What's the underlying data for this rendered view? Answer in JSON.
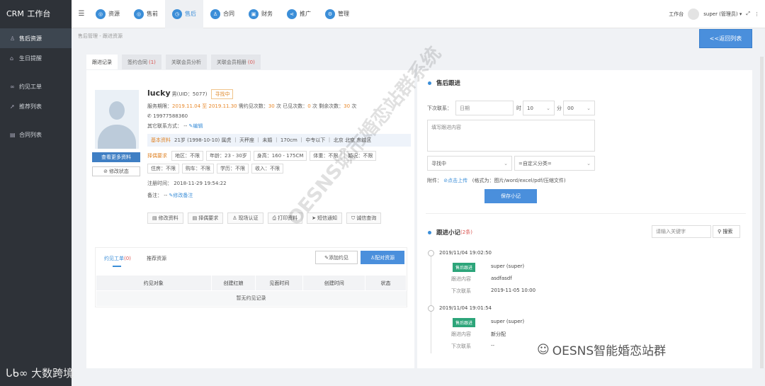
{
  "app": {
    "title": "CRM",
    "subtitle": "工作台"
  },
  "sidebar": {
    "items": [
      {
        "label": "售后资源",
        "icon": "user-icon",
        "active": true
      },
      {
        "label": "生日提醒",
        "icon": "gift-icon"
      },
      {
        "label": "约见工单",
        "icon": "link-icon"
      },
      {
        "label": "推荐列表",
        "icon": "share-icon"
      },
      {
        "label": "合同列表",
        "icon": "document-icon"
      }
    ],
    "brand": "大数跨境"
  },
  "topnav": {
    "items": [
      {
        "label": "资源",
        "icon": "globe-icon"
      },
      {
        "label": "售前",
        "icon": "globe-icon"
      },
      {
        "label": "售后",
        "icon": "clock-icon",
        "active": true
      },
      {
        "label": "合同",
        "icon": "user-icon"
      },
      {
        "label": "财务",
        "icon": "finance-icon"
      },
      {
        "label": "推广",
        "icon": "share-icon"
      },
      {
        "label": "管理",
        "icon": "settings-icon"
      }
    ],
    "workbench": "工作台",
    "user": "super (管理员)"
  },
  "breadcrumb": "售后管理 - 跟进资源",
  "back_button": "<<返回列表",
  "tabs": [
    {
      "label": "跟进记录",
      "active": true
    },
    {
      "label": "签约合同",
      "count": "(1)"
    },
    {
      "label": "关联会员分析"
    },
    {
      "label": "关联会员相册",
      "count": "(0)"
    }
  ],
  "profile": {
    "name": "lucky",
    "gender_uid": "男(UID：5077)",
    "status": "寻找中",
    "service_label": "服务期限：",
    "service_period": "2019.11.04 至 2019.11.30",
    "meet_total_label": "需约见次数：",
    "meet_total": "30",
    "unit": "次",
    "meet_done_label": "已见次数：",
    "meet_done": "0",
    "meet_left_label": "剩余次数：",
    "meet_left": "30",
    "phone": "19977588360",
    "other_contact": "其它联系方式： --",
    "edit": "编辑",
    "basic_label": "基本资料",
    "basic": "21岁 (1998-10-10) 属虎 ｜ 天秤座 ｜ 未婚 ｜ 170cm ｜ 中专以下 ｜ 北京 北京 东城区",
    "cond_label": "择偶要求",
    "conditions": [
      "地区：不限",
      "年龄：23 - 30岁",
      "身高：160 - 175CM",
      "体重：不限",
      "婚况：不限",
      "住房：不限",
      "购车：不限",
      "学历：不限",
      "收入：不限"
    ],
    "reg_time": "注册时间： 2018-11-29 19:54:22",
    "remark_label": "备注： --",
    "remark_edit": "修改备注",
    "more_btn": "查看更多资料",
    "status_btn": "修改状态",
    "actions": [
      "修改资料",
      "择偶要求",
      "现场认证",
      "打印资料",
      "短信通知",
      "诚信查询"
    ]
  },
  "lower": {
    "tab1": "约见工单",
    "tab1_count": "(0)",
    "tab2": "推荐资源",
    "add_btn": "添加约见",
    "match_btn": "配对资源",
    "columns": [
      "约见对象",
      "创建红娘",
      "见面时间",
      "创建时间",
      "状态"
    ],
    "empty": "暂无约见记录"
  },
  "followup": {
    "title": "售后跟进",
    "next_contact_label": "下次联系：",
    "date_value": "日期",
    "hour_label": "时",
    "hour_value": "10",
    "minute_label": "分",
    "minute_value": "00",
    "content_placeholder": "填写跟进内容",
    "select1": "寻找中",
    "select2": "=自定义分类=",
    "attach_label": "附件：",
    "upload": "点击上传",
    "attach_hint": "(格式为：图片/word/excel/pdf/压缩文件)",
    "save_btn": "保存小记"
  },
  "notes": {
    "title": "跟进小记",
    "count": "(2条)",
    "search_placeholder": "请输入关键字",
    "search_btn": "搜索",
    "entries": [
      {
        "time": "2019/11/04 19:02:50",
        "badge": "售后跟进",
        "user": "super (super)",
        "content_label": "跟进内容",
        "content": "asdfasdf",
        "next_label": "下次联系",
        "next": "2019-11-05 10:00"
      },
      {
        "time": "2019/11/04 19:01:54",
        "badge": "售后跟进",
        "user": "super (super)",
        "content_label": "跟进内容",
        "content": "新分配",
        "next_label": "下次联系",
        "next": "--"
      }
    ]
  },
  "watermark": "OESNS城市婚恋站群系统",
  "watermark2": "OESNS智能婚恋站群"
}
